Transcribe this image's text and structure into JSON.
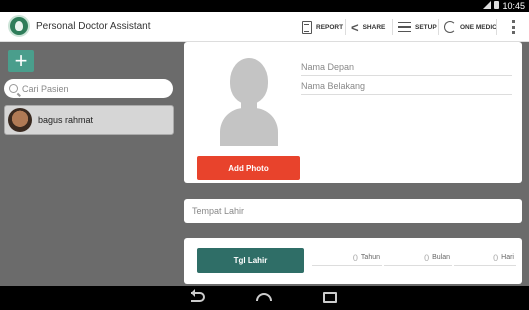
{
  "status_bar": {
    "time": "10:45"
  },
  "action_bar": {
    "title": "Personal Doctor Assistant",
    "actions": [
      {
        "label": "REPORT",
        "icon": "report-icon"
      },
      {
        "label": "SHARE",
        "icon": "share-icon"
      },
      {
        "label": "SETUP",
        "icon": "setup-icon"
      },
      {
        "label": "ONE MEDIC",
        "icon": "sync-icon"
      }
    ]
  },
  "sidebar": {
    "add_label": "+",
    "search_placeholder": "Cari Pasien",
    "patients": [
      {
        "name": "bagus rahmat"
      }
    ]
  },
  "form": {
    "first_name_placeholder": "Nama Depan",
    "last_name_placeholder": "Nama Belakang",
    "add_photo_label": "Add Photo",
    "birthplace_placeholder": "Tempat Lahir",
    "dob_button_label": "Tgl Lahir",
    "age": {
      "years_value": "0",
      "years_label": "Tahun",
      "months_value": "0",
      "months_label": "Bulan",
      "days_value": "0",
      "days_label": "Hari"
    }
  },
  "colors": {
    "accent_red": "#e8432c",
    "accent_teal": "#2f6e67",
    "add_button": "#4a9e8c"
  }
}
